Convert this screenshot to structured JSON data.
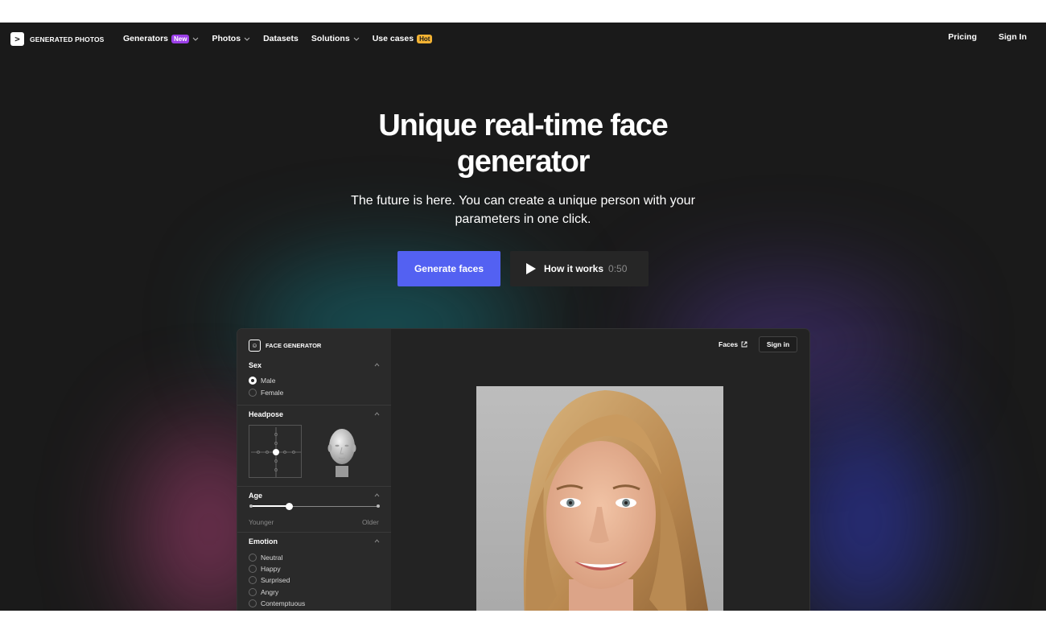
{
  "nav": {
    "logo_glyph": ">",
    "logo_text": "GENERATED PHOTOS",
    "items": [
      {
        "label": "Generators",
        "badge": "New"
      },
      {
        "label": "Photos"
      },
      {
        "label": "Datasets"
      },
      {
        "label": "Solutions"
      },
      {
        "label": "Use cases",
        "badge": "Hot"
      }
    ],
    "pricing": "Pricing",
    "signin": "Sign In"
  },
  "hero": {
    "title": "Unique real-time face generator",
    "subtitle": "The future is here. You can create a unique person with your parameters in one click.",
    "generate_label": "Generate faces",
    "how_label": "How it works",
    "how_duration": "0:50"
  },
  "app": {
    "logo_text": "FACE GENERATOR",
    "faces_link": "Faces",
    "signin": "Sign in",
    "sex": {
      "title": "Sex",
      "options": [
        "Male",
        "Female"
      ],
      "selected": "Male"
    },
    "headpose": {
      "title": "Headpose"
    },
    "age": {
      "title": "Age",
      "min_label": "Younger",
      "max_label": "Older",
      "value_fraction": 0.3
    },
    "emotion": {
      "title": "Emotion",
      "options": [
        "Neutral",
        "Happy",
        "Surprised",
        "Angry",
        "Contemptuous"
      ]
    }
  },
  "colors": {
    "background": "#1a1a1a",
    "accent": "#5361f2",
    "badge_new": "#9b3fe8",
    "badge_hot": "#f2b233"
  }
}
